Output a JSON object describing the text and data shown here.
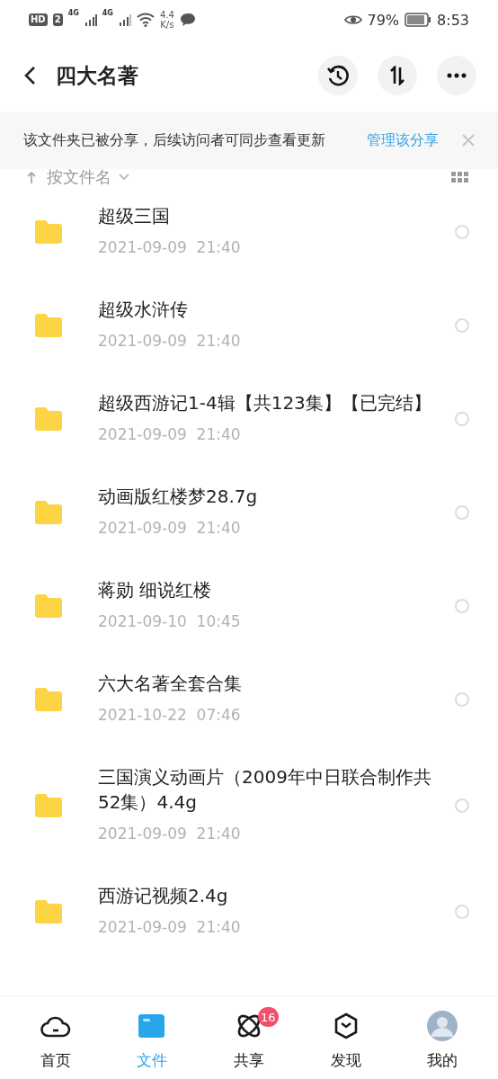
{
  "status_bar": {
    "hd": "HD",
    "sim": "2",
    "network_1": "4G",
    "network_2": "4G",
    "speed": "4.4",
    "speed_unit": "K/s",
    "battery_percent": "79%",
    "time": "8:53"
  },
  "header": {
    "title": "四大名著"
  },
  "share_banner": {
    "message": "该文件夹已被分享，后续访问者可同步查看更新",
    "link": "管理该分享"
  },
  "sort": {
    "label": "按文件名"
  },
  "files": [
    {
      "name": "超级三国",
      "date": "2021-09-09  21:40",
      "checked": false
    },
    {
      "name": "超级水浒传",
      "date": "2021-09-09  21:40",
      "checked": false
    },
    {
      "name": "超级西游记1-4辑【共123集】【已完结】",
      "date": "2021-09-09  21:40",
      "checked": false
    },
    {
      "name": "动画版红楼梦28.7g",
      "date": "2021-09-09  21:40",
      "checked": false
    },
    {
      "name": "蒋勋 细说红楼",
      "date": "2021-09-10  10:45",
      "checked": false
    },
    {
      "name": "六大名著全套合集",
      "date": "2021-10-22  07:46",
      "checked": false
    },
    {
      "name": "三国演义动画片（2009年中日联合制作共52集）4.4g",
      "date": "2021-09-09  21:40",
      "checked": false
    },
    {
      "name": "西游记视频2.4g",
      "date": "2021-09-09  21:40",
      "checked": false
    }
  ],
  "bottom_nav": [
    {
      "kind": "cloud",
      "label": "首页",
      "selected": false
    },
    {
      "kind": "folder",
      "label": "文件",
      "selected": true
    },
    {
      "kind": "atom",
      "label": "共享",
      "selected": false,
      "badge": "16"
    },
    {
      "kind": "cube",
      "label": "发现",
      "selected": false
    },
    {
      "kind": "avatar",
      "label": "我的",
      "selected": false
    }
  ]
}
